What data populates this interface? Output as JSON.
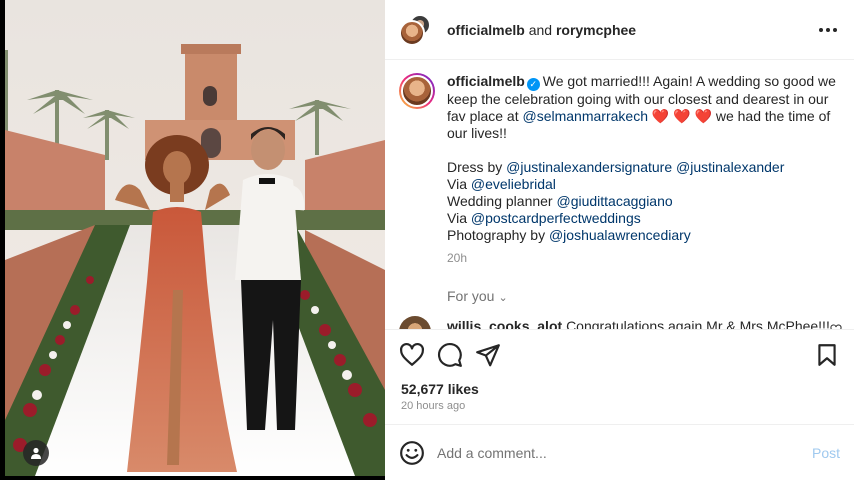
{
  "header": {
    "user1": "officialmelb",
    "connector": "and",
    "user2": "rorymcphee"
  },
  "caption": {
    "username": "officialmelb",
    "line1_a": "We got married!!! Again! A wedding so good we keep the celebration going with our closest and dearest in our fav place at ",
    "line1_mention": "@selmanmarrakech",
    "hearts": "❤️ ❤️ ❤️",
    "line1_b": "we had the time of our lives!!",
    "dress_label": "Dress by ",
    "dress_mention1": "@justinalexandersignature",
    "dress_mention2": "@justinalexander",
    "via1_label": "Via ",
    "via1_mention": "@eveliebridal",
    "planner_label": "Wedding planner ",
    "planner_mention": "@giudittacaggiano",
    "via2_label": "Via ",
    "via2_mention": "@postcardperfectweddings",
    "photo_label": "Photography by ",
    "photo_mention": "@joshualawrencediary",
    "time_ago": "20h"
  },
  "for_you": "For you",
  "comment": {
    "username": "willis_cooks_alot",
    "text": "Congratulations again Mr & Mrs McPhee!!!"
  },
  "likes": "52,677 likes",
  "posted": "20 hours ago",
  "add_comment": {
    "placeholder": "Add a comment...",
    "post_label": "Post"
  },
  "colors": {
    "link": "#00376b",
    "verified": "#0095f6",
    "post_disabled": "#9fc9ef"
  }
}
